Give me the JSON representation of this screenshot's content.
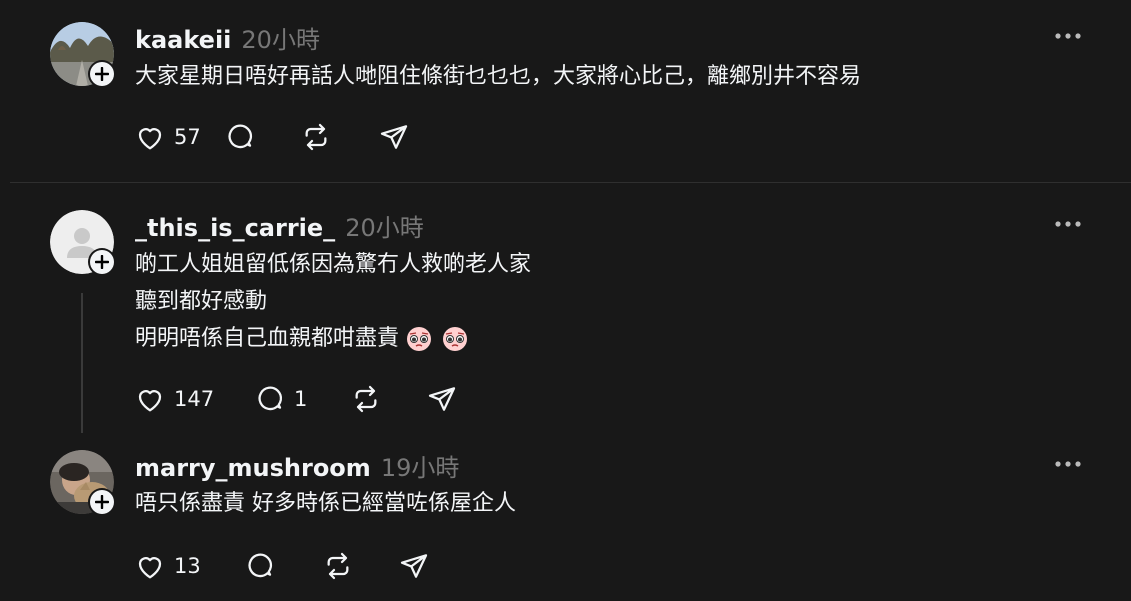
{
  "posts": [
    {
      "username": "kaakeii",
      "time": "20小時",
      "lines": [
        "大家星期日唔好再話人哋阻住條街乜乜乜，大家將心比己，離鄉別井不容易"
      ],
      "likes": "57",
      "replies": "",
      "avatar": "photo-trees-path"
    },
    {
      "username": "_this_is_carrie_",
      "time": "20小時",
      "lines": [
        "啲工人姐姐留低係因為驚冇人救啲老人家",
        "聽到都好感動",
        "明明唔係自己血親都咁盡責"
      ],
      "emoji": [
        "pleading-face",
        "pleading-face"
      ],
      "likes": "147",
      "replies": "1",
      "avatar": "default-person"
    },
    {
      "username": "marry_mushroom",
      "time": "19小時",
      "lines": [
        "唔只係盡責 好多時係已經當咗係屋企￼人"
      ],
      "likes": "13",
      "replies": "",
      "avatar": "photo-cat"
    }
  ],
  "colors": {
    "background": "#181818",
    "text": "#f3f5f7",
    "muted": "#777777",
    "divider": "#2f2f2f"
  }
}
